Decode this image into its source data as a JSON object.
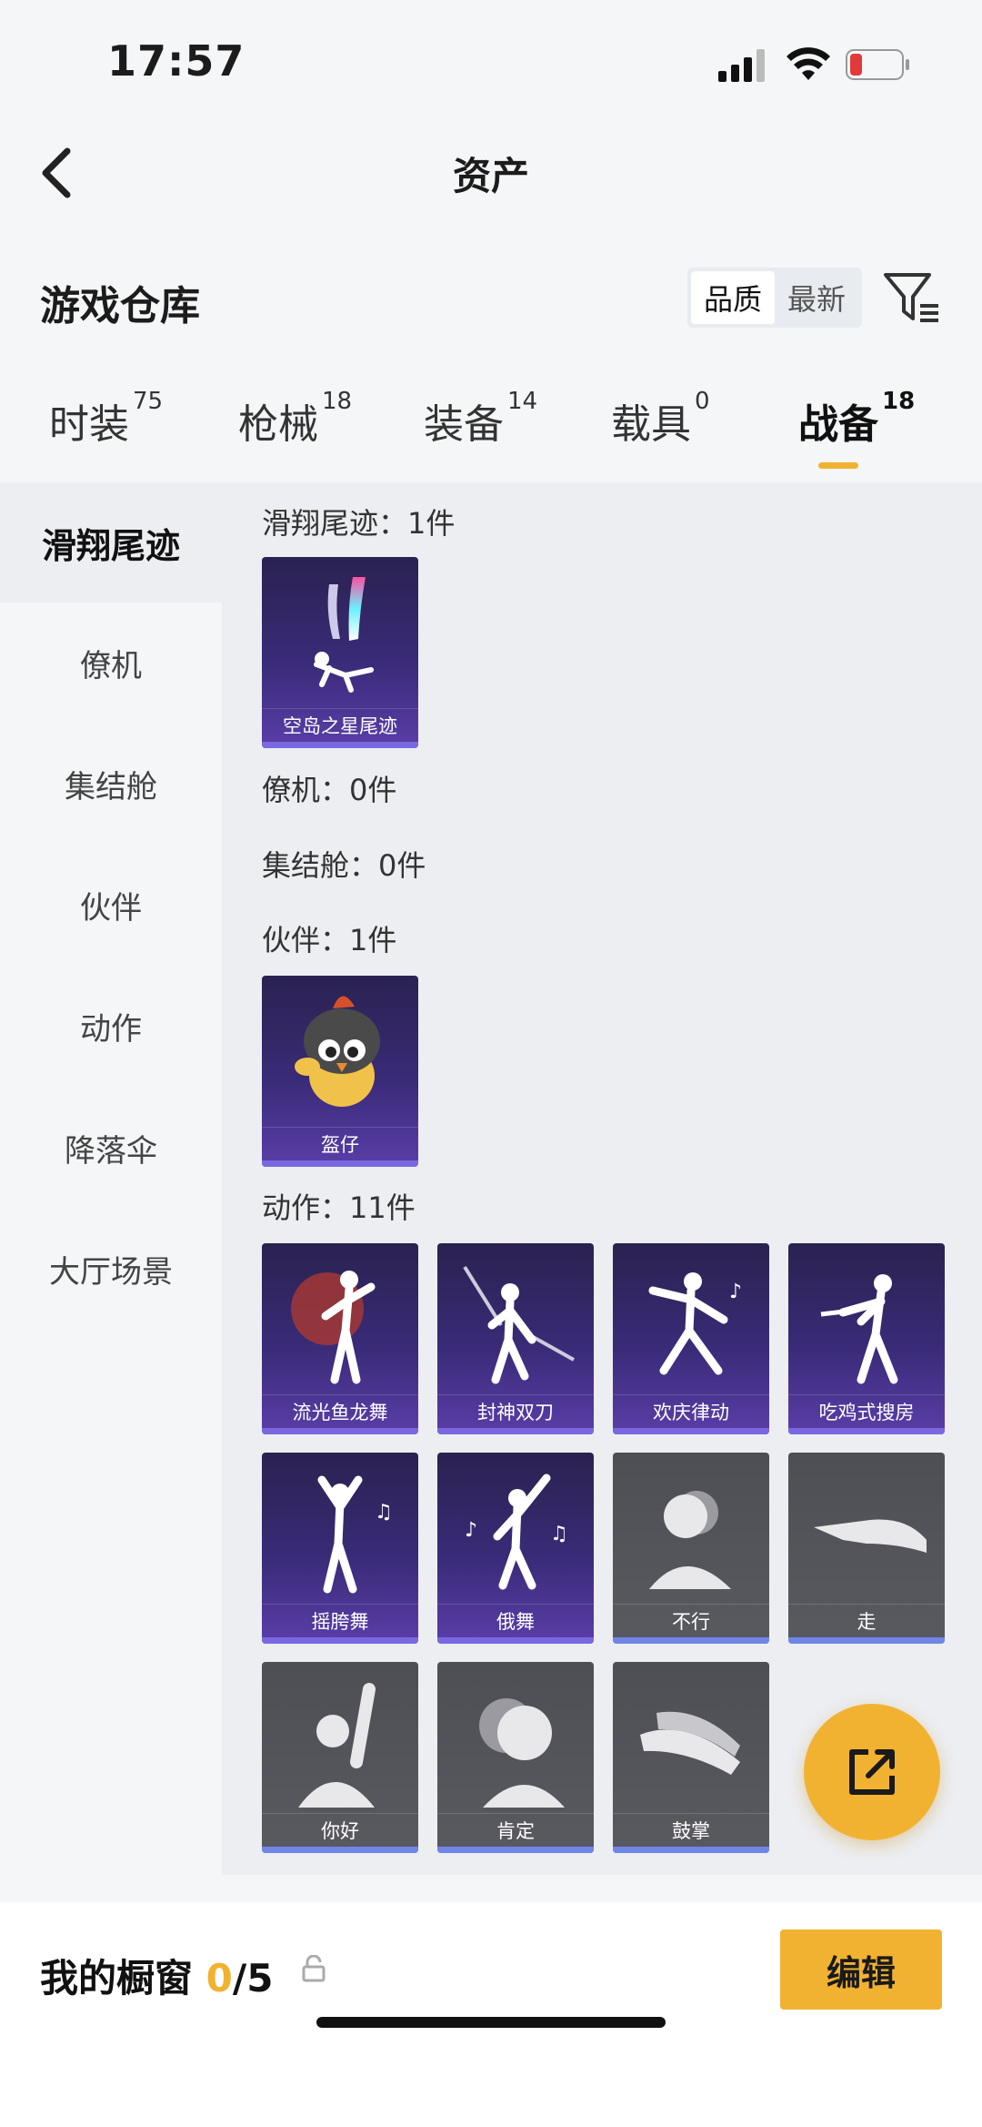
{
  "status": {
    "time": "17:57"
  },
  "nav": {
    "title": "资产"
  },
  "header": {
    "title": "游戏仓库",
    "sort": [
      "品质",
      "最新"
    ]
  },
  "tabs": [
    {
      "label": "时装",
      "count": "75"
    },
    {
      "label": "枪械",
      "count": "18"
    },
    {
      "label": "装备",
      "count": "14"
    },
    {
      "label": "载具",
      "count": "0"
    },
    {
      "label": "战备",
      "count": "18"
    }
  ],
  "sidebar": [
    "滑翔尾迹",
    "僚机",
    "集结舱",
    "伙伴",
    "动作",
    "降落伞",
    "大厅场景"
  ],
  "sections": {
    "trail": "滑翔尾迹：1件",
    "wingman": "僚机：0件",
    "capsule": "集结舱：0件",
    "partner": "伙伴：1件",
    "emote": "动作：11件"
  },
  "items": {
    "trail": [
      "空岛之星尾迹"
    ],
    "partner": [
      "盔仔"
    ],
    "emote": [
      "流光鱼龙舞",
      "封神双刀",
      "欢庆律动",
      "吃鸡式搜房",
      "摇胯舞",
      "俄舞",
      "不行",
      "走",
      "你好",
      "肯定",
      "鼓掌"
    ]
  },
  "bottom": {
    "label": "我的橱窗",
    "count": "0",
    "max": "/5",
    "edit": "编辑"
  },
  "colors": {
    "accent": "#f2b231",
    "purple_card": "#3a2b78",
    "gray_card": "#55555c"
  }
}
